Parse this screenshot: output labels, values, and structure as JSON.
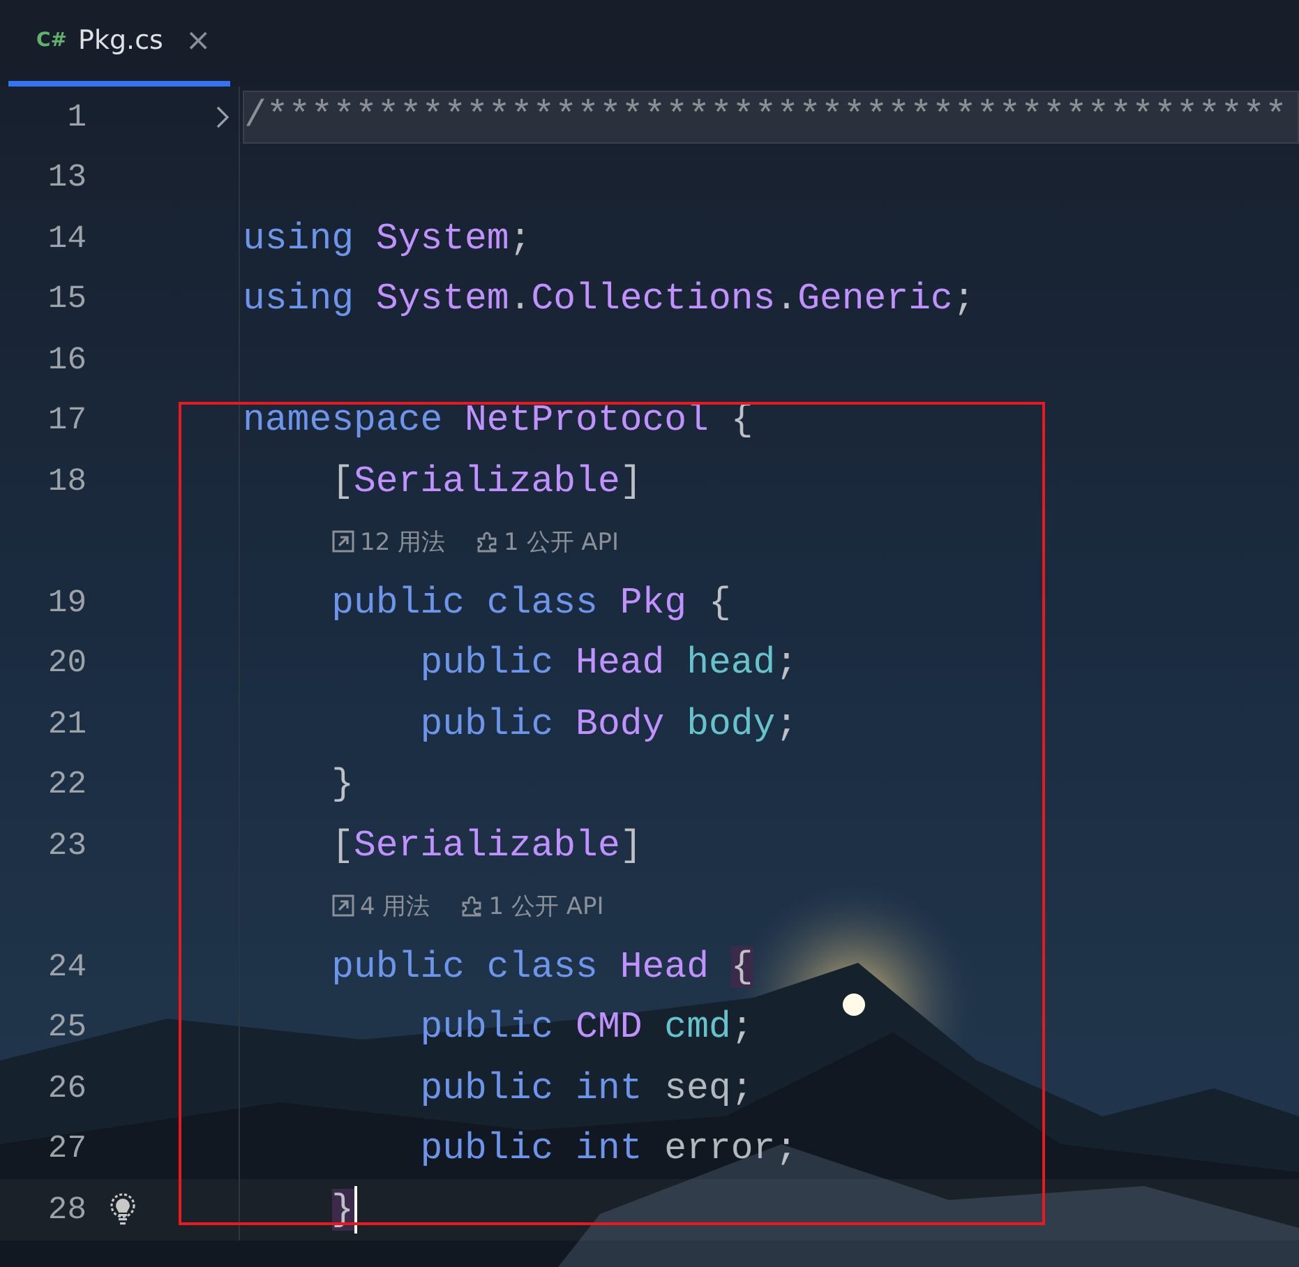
{
  "tabs": [
    {
      "badge": "C#",
      "title": "Pkg.cs",
      "close": "×",
      "selected": true
    }
  ],
  "lines": [
    {
      "kind": "code",
      "number": "1",
      "folded": true,
      "current": false,
      "tokens": [
        {
          "text": "/**********************************************",
          "kind": "comment"
        }
      ]
    },
    {
      "kind": "code",
      "number": "13",
      "folded": false,
      "current": false
    },
    {
      "kind": "code",
      "number": "14",
      "folded": false,
      "current": false,
      "tokens": [
        {
          "text": "using ",
          "kind": "keyword"
        },
        {
          "text": "System",
          "kind": "type"
        },
        {
          "text": ";",
          "kind": "plain"
        }
      ]
    },
    {
      "kind": "code",
      "number": "15",
      "folded": false,
      "current": false,
      "tokens": [
        {
          "text": "using ",
          "kind": "keyword"
        },
        {
          "text": "System",
          "kind": "type"
        },
        {
          "text": ".",
          "kind": "plain"
        },
        {
          "text": "Collections",
          "kind": "type"
        },
        {
          "text": ".",
          "kind": "plain"
        },
        {
          "text": "Generic",
          "kind": "type"
        },
        {
          "text": ";",
          "kind": "plain"
        }
      ]
    },
    {
      "kind": "code",
      "number": "16",
      "folded": false,
      "current": false
    },
    {
      "kind": "code",
      "number": "17",
      "folded": false,
      "current": false,
      "tokens": [
        {
          "text": "namespace ",
          "kind": "keyword"
        },
        {
          "text": "NetProtocol",
          "kind": "type"
        },
        {
          "text": " {",
          "kind": "plain"
        }
      ]
    },
    {
      "kind": "code",
      "number": "18",
      "folded": false,
      "current": false,
      "tokens": [
        {
          "text": "    [",
          "kind": "plain"
        },
        {
          "text": "Serializable",
          "kind": "type"
        },
        {
          "text": "]",
          "kind": "plain"
        }
      ]
    },
    {
      "kind": "hint",
      "usages": "12 用法",
      "api": "1 公开 API"
    },
    {
      "kind": "code",
      "number": "19",
      "folded": false,
      "current": false,
      "tokens": [
        {
          "text": "    public class ",
          "kind": "keyword"
        },
        {
          "text": "Pkg",
          "kind": "type"
        },
        {
          "text": " {",
          "kind": "plain"
        }
      ]
    },
    {
      "kind": "code",
      "number": "20",
      "folded": false,
      "current": false,
      "tokens": [
        {
          "text": "        public ",
          "kind": "keyword"
        },
        {
          "text": "Head",
          "kind": "type"
        },
        {
          "text": " head",
          "kind": "field"
        },
        {
          "text": ";",
          "kind": "plain"
        }
      ]
    },
    {
      "kind": "code",
      "number": "21",
      "folded": false,
      "current": false,
      "tokens": [
        {
          "text": "        public ",
          "kind": "keyword"
        },
        {
          "text": "Body",
          "kind": "type"
        },
        {
          "text": " body",
          "kind": "field"
        },
        {
          "text": ";",
          "kind": "plain"
        }
      ]
    },
    {
      "kind": "code",
      "number": "22",
      "folded": false,
      "current": false,
      "tokens": [
        {
          "text": "    }",
          "kind": "plain"
        }
      ]
    },
    {
      "kind": "code",
      "number": "23",
      "folded": false,
      "current": false,
      "tokens": [
        {
          "text": "    [",
          "kind": "plain"
        },
        {
          "text": "Serializable",
          "kind": "type"
        },
        {
          "text": "]",
          "kind": "plain"
        }
      ]
    },
    {
      "kind": "hint",
      "usages": "4 用法",
      "api": "1 公开 API"
    },
    {
      "kind": "code",
      "number": "24",
      "folded": false,
      "current": false,
      "tokens": [
        {
          "text": "    public class ",
          "kind": "keyword"
        },
        {
          "text": "Head",
          "kind": "type"
        },
        {
          "text": " {",
          "kind": "brace_match"
        }
      ]
    },
    {
      "kind": "code",
      "number": "25",
      "folded": false,
      "current": false,
      "tokens": [
        {
          "text": "        public ",
          "kind": "keyword"
        },
        {
          "text": "CMD",
          "kind": "type"
        },
        {
          "text": " cmd",
          "kind": "field"
        },
        {
          "text": ";",
          "kind": "plain"
        }
      ]
    },
    {
      "kind": "code",
      "number": "26",
      "folded": false,
      "current": false,
      "tokens": [
        {
          "text": "        public int ",
          "kind": "keyword"
        },
        {
          "text": "seq",
          "kind": "unused"
        },
        {
          "text": ";",
          "kind": "plain"
        }
      ]
    },
    {
      "kind": "code",
      "number": "27",
      "folded": false,
      "current": false,
      "tokens": [
        {
          "text": "        public int ",
          "kind": "keyword"
        },
        {
          "text": "error",
          "kind": "unused"
        },
        {
          "text": ";",
          "kind": "plain"
        }
      ]
    },
    {
      "kind": "code",
      "number": "28",
      "folded": false,
      "current": true,
      "tokens": [
        {
          "text": "    }",
          "kind": "brace_match"
        }
      ]
    }
  ],
  "annotation": {
    "kind": "rectangle"
  }
}
